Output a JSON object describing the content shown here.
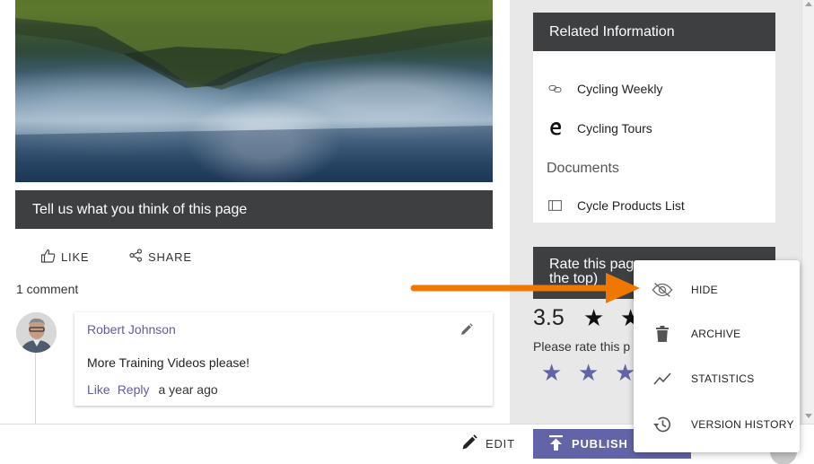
{
  "feedback": {
    "title": "Tell us what you think of this page"
  },
  "actions": {
    "like_label": "LIKE",
    "share_label": "SHARE"
  },
  "comments": {
    "count_label": "1 comment",
    "items": [
      {
        "author": "Robert Johnson",
        "text": "More Training Videos please!",
        "like_label": "Like",
        "reply_label": "Reply",
        "time": "a year ago"
      }
    ]
  },
  "related": {
    "title": "Related Information",
    "links": [
      {
        "label": "Cycling Weekly",
        "icon": "link-icon"
      },
      {
        "label": "Cycling Tours",
        "icon": "edge-browser-icon"
      }
    ],
    "documents_heading": "Documents",
    "documents": [
      {
        "label": "Cycle Products List",
        "icon": "list-layout-icon"
      }
    ]
  },
  "rating": {
    "title_line1": "Rate this pag",
    "title_line2": "the top)",
    "value": "3.5",
    "average_stars_filled_visible": 2,
    "prompt": "Please rate this p",
    "stars_visible": 3
  },
  "bottom_bar": {
    "edit_label": "EDIT",
    "publish_label": "PUBLISH"
  },
  "menu": {
    "items": [
      {
        "label": "HIDE",
        "icon": "hide-eye-icon"
      },
      {
        "label": "ARCHIVE",
        "icon": "trash-icon"
      },
      {
        "label": "STATISTICS",
        "icon": "trend-line-icon"
      },
      {
        "label": "VERSION HISTORY",
        "icon": "history-clock-icon"
      }
    ]
  },
  "colors": {
    "accent": "#6264a7",
    "header_dark": "#3d3f41",
    "arrow": "#f07800",
    "sidebar_bg": "#e8e8e8"
  }
}
